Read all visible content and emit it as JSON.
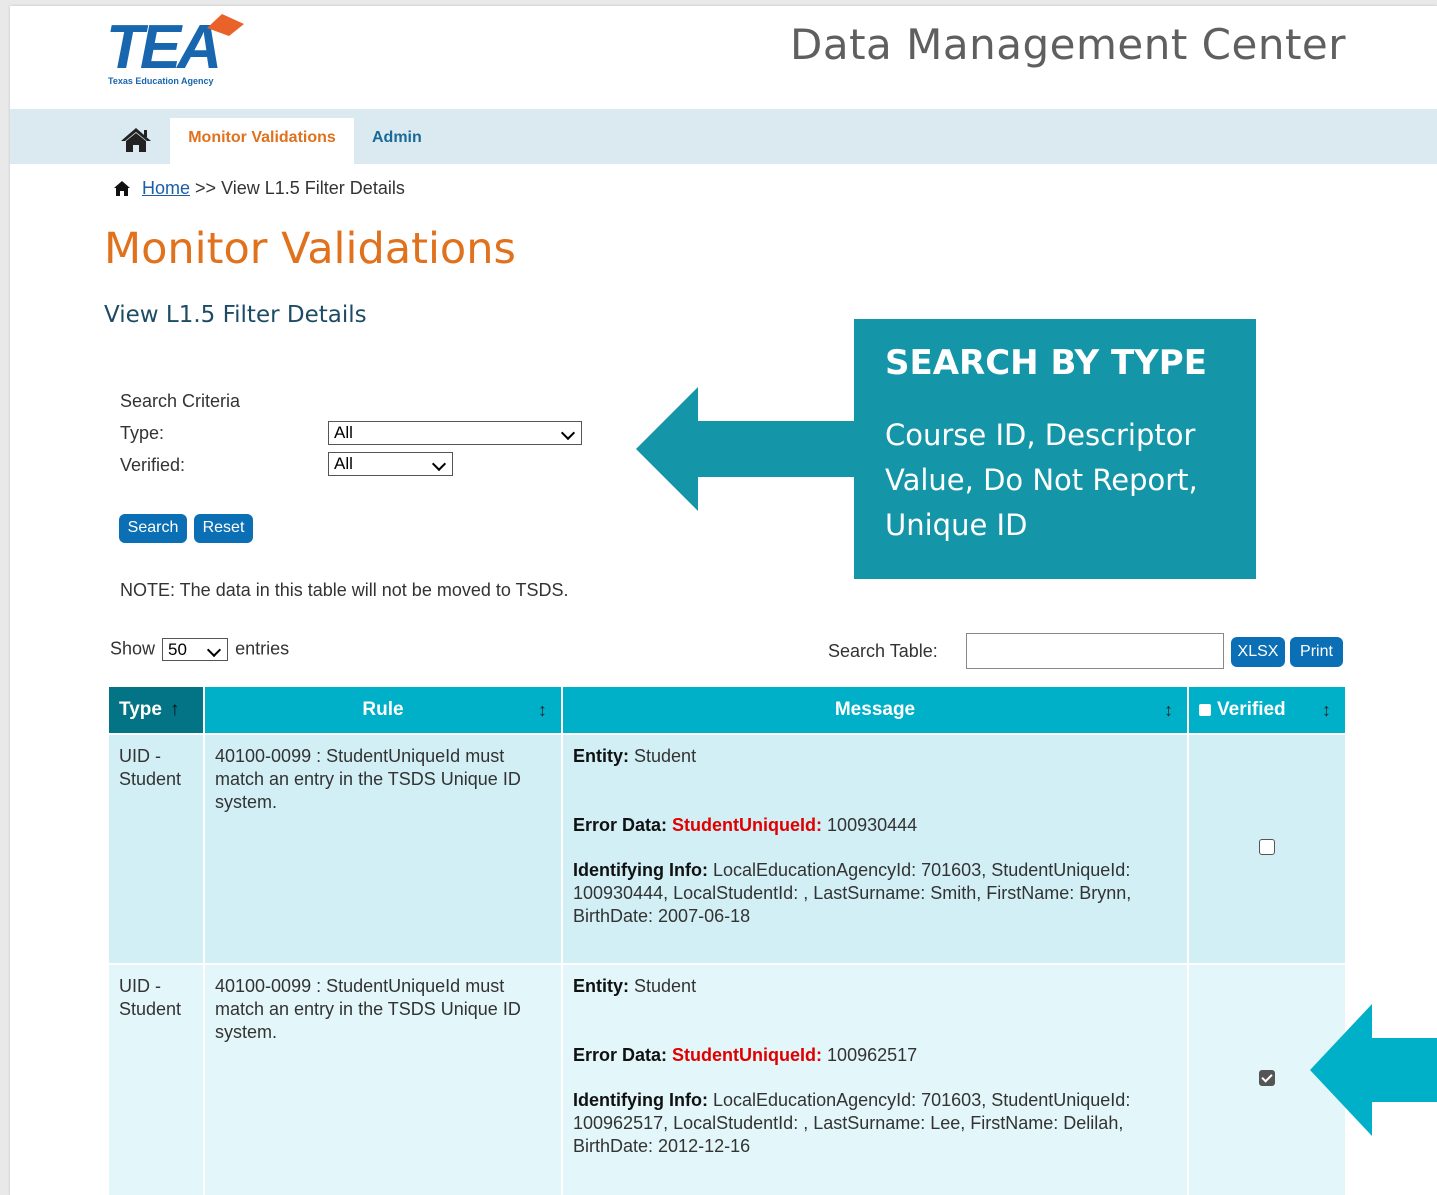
{
  "header": {
    "logo_text": "TEA",
    "logo_subtext": "Texas Education Agency",
    "app_title": "Data Management Center"
  },
  "nav": {
    "home_icon": "home-icon",
    "tabs": [
      {
        "label": "Monitor Validations",
        "active": true
      },
      {
        "label": "Admin",
        "active": false
      }
    ]
  },
  "breadcrumb": {
    "home_label": "Home",
    "separator": ">>",
    "current": "View L1.5 Filter Details"
  },
  "page": {
    "title": "Monitor Validations",
    "subtitle": "View L1.5 Filter Details"
  },
  "search": {
    "criteria_title": "Search Criteria",
    "type_label": "Type:",
    "type_value": "All",
    "verified_label": "Verified:",
    "verified_value": "All",
    "search_button": "Search",
    "reset_button": "Reset"
  },
  "note": "NOTE: The data in this table will not be moved to TSDS.",
  "callout": {
    "title": "SEARCH BY TYPE",
    "body": "Course ID, Descriptor Value, Do Not Report, Unique ID",
    "color": "#1496a8"
  },
  "table_controls": {
    "show_label": "Show",
    "entries_value": "50",
    "entries_label": "entries",
    "search_label": "Search Table:",
    "search_value": "",
    "xlsx_button": "XLSX",
    "print_button": "Print"
  },
  "table": {
    "columns": [
      "Type",
      "Rule",
      "Message",
      "Verified"
    ],
    "rows": [
      {
        "type_line1": "UID -",
        "type_line2": "Student",
        "rule": "40100-0099 : StudentUniqueId must match an entry in the TSDS Unique ID system.",
        "entity_label": "Entity:",
        "entity_value": "Student",
        "error_label": "Error Data:",
        "error_field": "StudentUniqueId:",
        "error_value": "100930444",
        "ident_label": "Identifying Info:",
        "ident_value": "LocalEducationAgencyId: 701603, StudentUniqueId: 100930444, LocalStudentId: , LastSurname: Smith, FirstName: Brynn, BirthDate: 2007-06-18",
        "verified": false
      },
      {
        "type_line1": "UID -",
        "type_line2": "Student",
        "rule": "40100-0099 : StudentUniqueId must match an entry in the TSDS Unique ID system.",
        "entity_label": "Entity:",
        "entity_value": "Student",
        "error_label": "Error Data:",
        "error_field": "StudentUniqueId:",
        "error_value": "100962517",
        "ident_label": "Identifying Info:",
        "ident_value": "LocalEducationAgencyId: 701603, StudentUniqueId: 100962517, LocalStudentId: , LastSurname: Lee, FirstName: Delilah, BirthDate: 2012-12-16",
        "verified": true
      }
    ]
  },
  "colors": {
    "accent_orange": "#e0711d",
    "header_teal": "#00b0c8",
    "header_dark_teal": "#037485",
    "button_blue": "#0a6fb4",
    "arrow_teal": "#1496a8"
  }
}
